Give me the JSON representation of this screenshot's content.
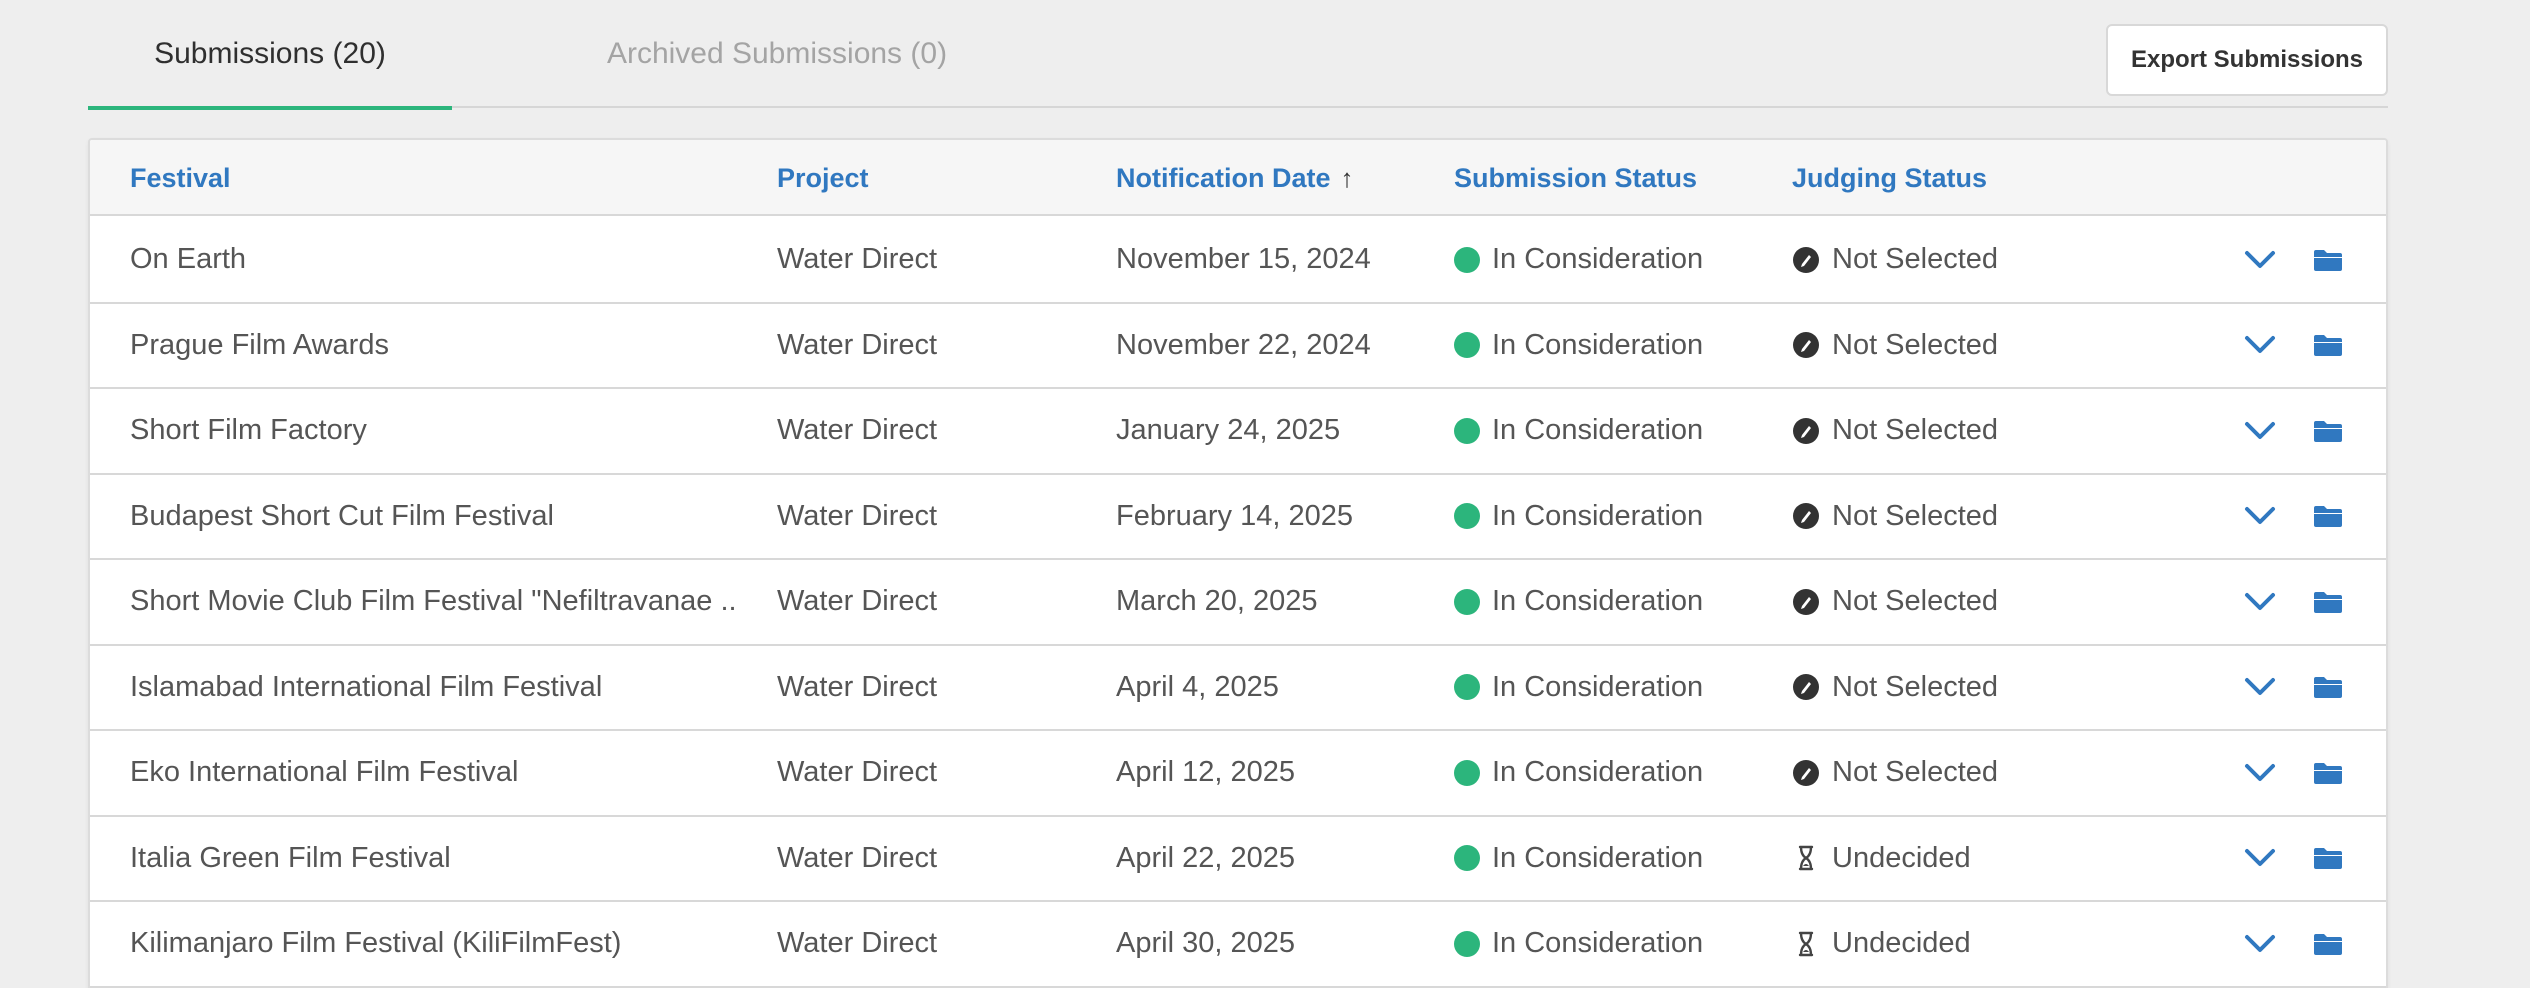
{
  "tabs": {
    "active_label": "Submissions (20)",
    "inactive_label": "Archived Submissions (0)"
  },
  "export_label": "Export Submissions",
  "columns": {
    "festival": "Festival",
    "project": "Project",
    "notification_date": "Notification Date",
    "sort_indicator": "↑",
    "submission_status": "Submission Status",
    "judging_status": "Judging Status"
  },
  "colors": {
    "accent_green": "#2cb57c",
    "link_blue": "#3078c0"
  },
  "rows": [
    {
      "festival": "On Earth",
      "project": "Water Direct",
      "date": "November 15, 2024",
      "submission_status": "In Consideration",
      "judging_status": "Not Selected",
      "judging_icon": "not-selected-icon"
    },
    {
      "festival": "Prague Film Awards",
      "project": "Water Direct",
      "date": "November 22, 2024",
      "submission_status": "In Consideration",
      "judging_status": "Not Selected",
      "judging_icon": "not-selected-icon"
    },
    {
      "festival": "Short Film Factory",
      "project": "Water Direct",
      "date": "January 24, 2025",
      "submission_status": "In Consideration",
      "judging_status": "Not Selected",
      "judging_icon": "not-selected-icon"
    },
    {
      "festival": "Budapest Short Cut Film Festival",
      "project": "Water Direct",
      "date": "February 14, 2025",
      "submission_status": "In Consideration",
      "judging_status": "Not Selected",
      "judging_icon": "not-selected-icon"
    },
    {
      "festival": "Short Movie Club Film Festival \"Nefiltravanae ...",
      "project": "Water Direct",
      "date": "March 20, 2025",
      "submission_status": "In Consideration",
      "judging_status": "Not Selected",
      "judging_icon": "not-selected-icon"
    },
    {
      "festival": "Islamabad International Film Festival",
      "project": "Water Direct",
      "date": "April 4, 2025",
      "submission_status": "In Consideration",
      "judging_status": "Not Selected",
      "judging_icon": "not-selected-icon"
    },
    {
      "festival": "Eko International Film Festival",
      "project": "Water Direct",
      "date": "April 12, 2025",
      "submission_status": "In Consideration",
      "judging_status": "Not Selected",
      "judging_icon": "not-selected-icon"
    },
    {
      "festival": "Italia Green Film Festival",
      "project": "Water Direct",
      "date": "April 22, 2025",
      "submission_status": "In Consideration",
      "judging_status": "Undecided",
      "judging_icon": "hourglass-icon"
    },
    {
      "festival": "Kilimanjaro Film Festival (KiliFilmFest)",
      "project": "Water Direct",
      "date": "April 30, 2025",
      "submission_status": "In Consideration",
      "judging_status": "Undecided",
      "judging_icon": "hourglass-icon"
    }
  ]
}
